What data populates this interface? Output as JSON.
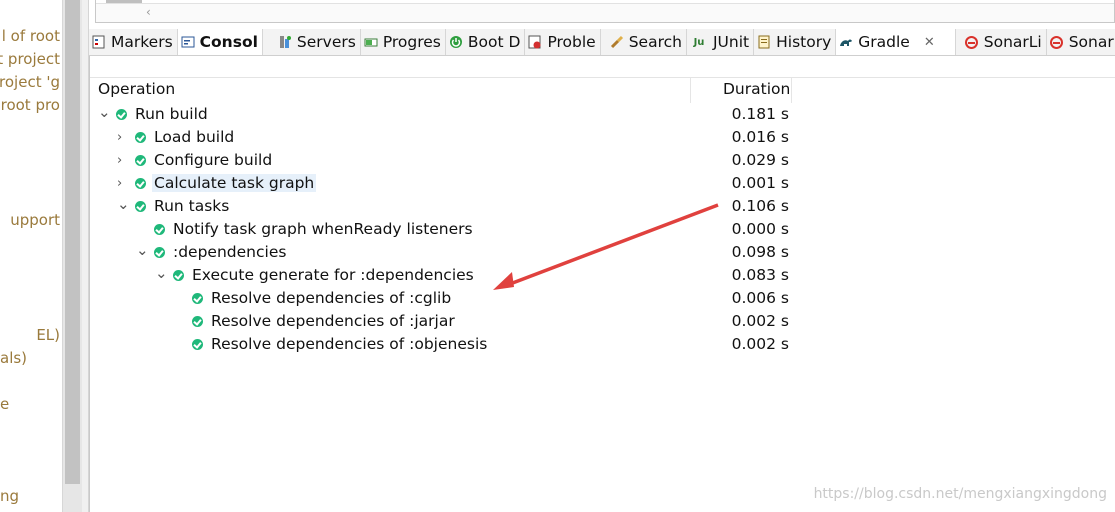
{
  "left_pane": {
    "lines": [
      "l of root",
      "t project",
      "project 'g",
      "root pro",
      "upport",
      "EL)",
      "als)",
      "e",
      "ng"
    ]
  },
  "tabs": [
    {
      "label": "Markers",
      "icon": "markers-icon"
    },
    {
      "label": "Consol",
      "icon": "console-icon"
    },
    {
      "label": "Servers",
      "icon": "servers-icon"
    },
    {
      "label": "Progres",
      "icon": "progress-icon"
    },
    {
      "label": "Boot D",
      "icon": "boot-dashboard-icon"
    },
    {
      "label": "Proble",
      "icon": "problems-icon"
    },
    {
      "label": "Search",
      "icon": "search-icon"
    },
    {
      "label": "JUnit",
      "icon": "junit-icon"
    },
    {
      "label": "History",
      "icon": "history-icon"
    },
    {
      "label": "Gradle",
      "icon": "gradle-icon"
    },
    {
      "label": "SonarLi",
      "icon": "sonarlint-icon"
    },
    {
      "label": "SonarLi",
      "icon": "sonarlint-icon"
    }
  ],
  "columns": {
    "operation": "Operation",
    "duration": "Duration"
  },
  "rows": [
    {
      "level": 0,
      "twisty": "expanded",
      "label": "Run build",
      "duration": "0.181 s"
    },
    {
      "level": 1,
      "twisty": "collapsed",
      "label": "Load build",
      "duration": "0.016 s"
    },
    {
      "level": 1,
      "twisty": "collapsed",
      "label": "Configure build",
      "duration": "0.029 s"
    },
    {
      "level": 1,
      "twisty": "collapsed",
      "label": "Calculate task graph",
      "duration": "0.001 s",
      "selected": true
    },
    {
      "level": 1,
      "twisty": "expanded",
      "label": "Run tasks",
      "duration": "0.106 s"
    },
    {
      "level": 2,
      "twisty": "none",
      "label": "Notify task graph whenReady listeners",
      "duration": "0.000 s"
    },
    {
      "level": 2,
      "twisty": "expanded",
      "label": ":dependencies",
      "duration": "0.098 s"
    },
    {
      "level": 3,
      "twisty": "expanded",
      "label": "Execute generate for :dependencies",
      "duration": "0.083 s"
    },
    {
      "level": 4,
      "twisty": "none",
      "label": "Resolve dependencies of :cglib",
      "duration": "0.006 s"
    },
    {
      "level": 4,
      "twisty": "none",
      "label": "Resolve dependencies of :jarjar",
      "duration": "0.002 s"
    },
    {
      "level": 4,
      "twisty": "none",
      "label": "Resolve dependencies of :objenesis",
      "duration": "0.002 s"
    }
  ],
  "watermark": "https://blog.csdn.net/mengxiangxingdong",
  "colors": {
    "success": "#1fb87a",
    "annotation_arrow": "#e0413e"
  }
}
